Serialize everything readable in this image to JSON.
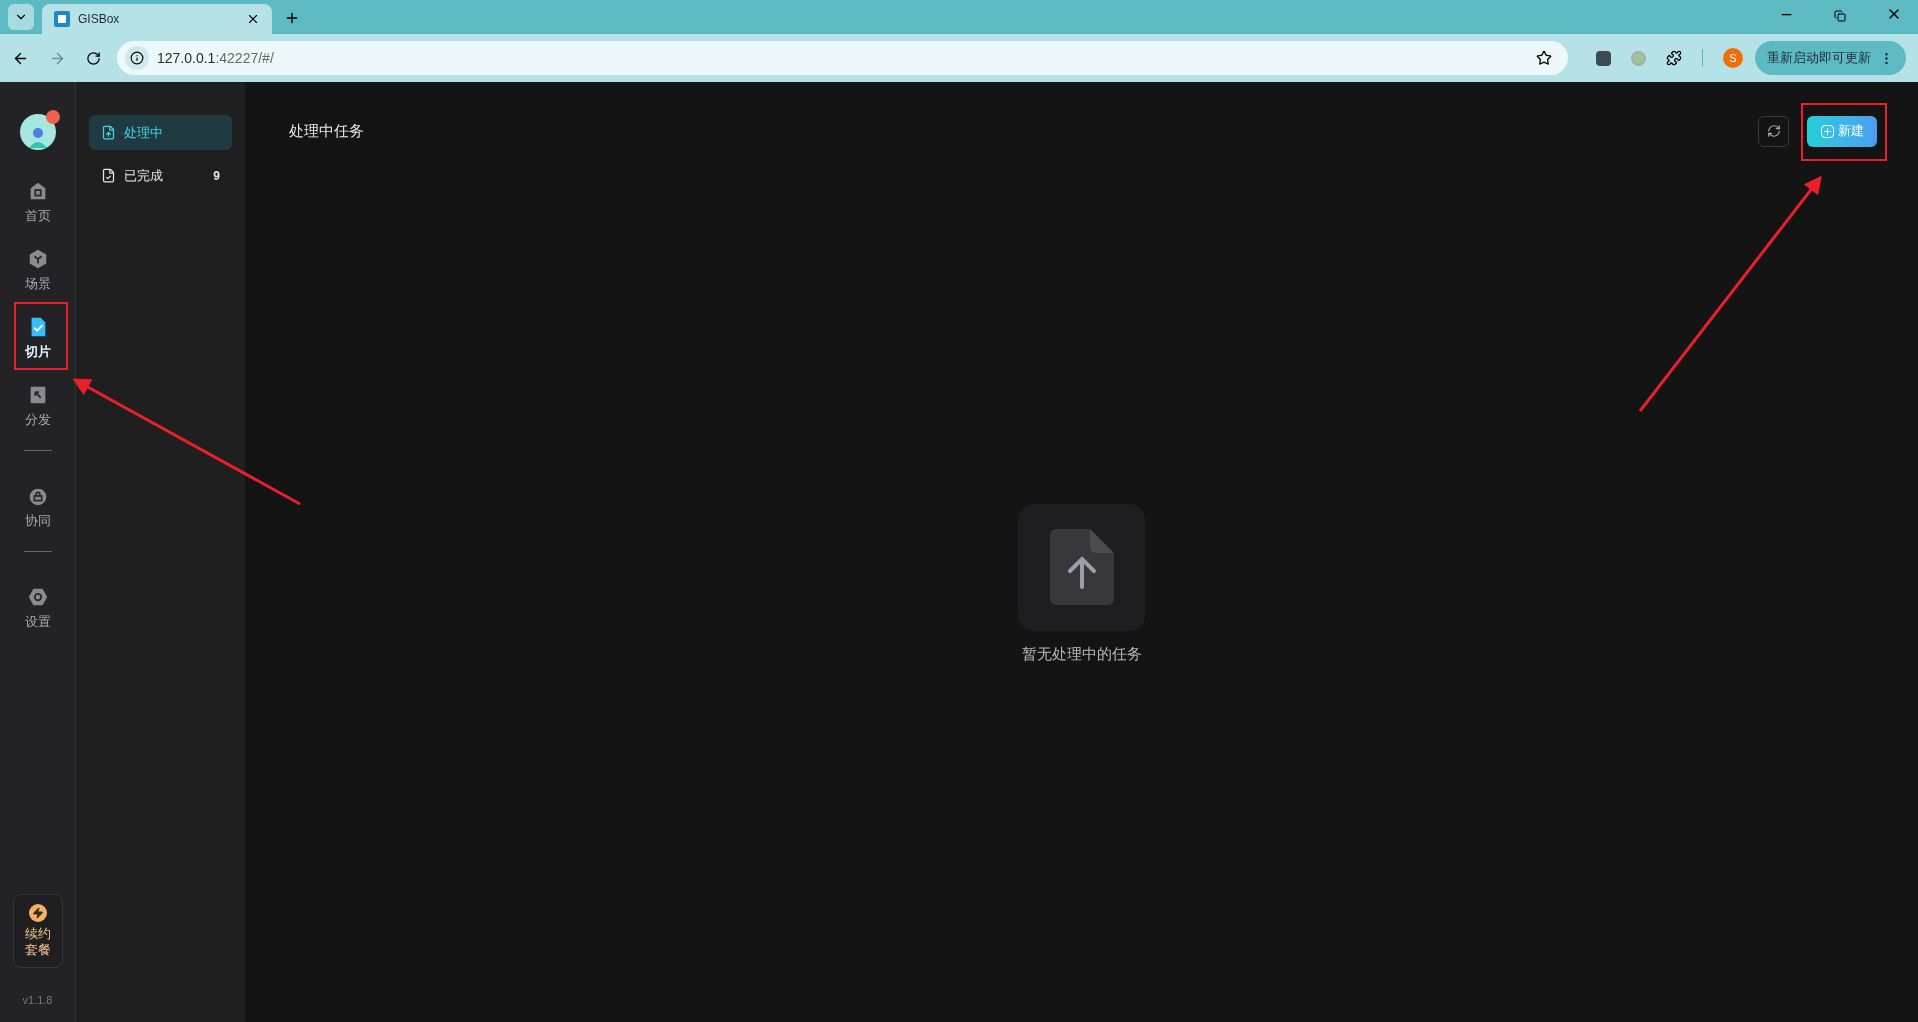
{
  "browser": {
    "tabs": [
      {
        "title": "GISBox",
        "selected": true
      }
    ],
    "url": {
      "host": "127.0.0.1",
      "rest": ":42227/#/"
    },
    "profile_initial": "S",
    "update_button": "重新启动即可更新"
  },
  "rail": {
    "items": [
      {
        "kind": "nav",
        "label": "首页",
        "selected": false
      },
      {
        "kind": "nav",
        "label": "场景",
        "selected": false
      },
      {
        "kind": "nav",
        "label": "切片",
        "selected": true
      },
      {
        "kind": "nav",
        "label": "分发",
        "selected": false
      },
      {
        "kind": "divider"
      },
      {
        "kind": "nav",
        "label": "协同",
        "selected": false
      },
      {
        "kind": "divider"
      },
      {
        "kind": "nav",
        "label": "设置",
        "selected": false
      }
    ],
    "renew_card": "续约套餐",
    "version": "v1.1.8"
  },
  "task_menu": {
    "items": [
      {
        "label": "处理中",
        "selected": true
      },
      {
        "label": "已完成",
        "selected": false,
        "count": "9"
      }
    ]
  },
  "main": {
    "title": "处理中任务",
    "new_button": "新建",
    "empty_state": "暂无处理中的任务"
  }
}
